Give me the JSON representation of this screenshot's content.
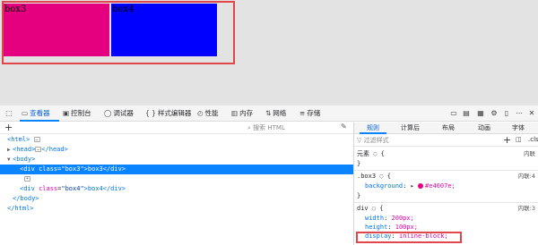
{
  "viewport": {
    "box3_label": "box3",
    "box4_label": "box4",
    "box3_color": "#e4007e",
    "box4_color": "#0000ff"
  },
  "toolbar": {
    "tabs": [
      {
        "icon": "inspector-icon",
        "label": "查看器"
      },
      {
        "icon": "console-icon",
        "label": "控制台"
      },
      {
        "icon": "debugger-icon",
        "label": "调试器"
      },
      {
        "icon": "style-editor-icon",
        "label": "样式编辑器",
        "prefix": "{ }"
      },
      {
        "icon": "performance-icon",
        "label": "性能"
      },
      {
        "icon": "memory-icon",
        "label": "内存"
      },
      {
        "icon": "network-icon",
        "label": "网络"
      },
      {
        "icon": "storage-icon",
        "label": "存储"
      }
    ]
  },
  "inspector": {
    "search_placeholder": "搜索 HTML",
    "tree": [
      {
        "indent": 0,
        "text_parts": [
          "<html>"
        ]
      },
      {
        "indent": 1,
        "text_parts": [
          "<head>",
          "</head>"
        ]
      },
      {
        "indent": 1,
        "text_parts": [
          "<body>"
        ]
      },
      {
        "indent": 2,
        "tag_open": "<div ",
        "attr": "class",
        "val": "\"box3\"",
        "content": ">box3</div>",
        "selected": true
      },
      {
        "indent": 2,
        "text_parts": [
          "<div ",
          "class",
          "\"box4\"",
          ">box4</div>"
        ]
      },
      {
        "indent": 1,
        "text_parts": [
          "</body>"
        ]
      },
      {
        "indent": 0,
        "text_parts": [
          "</html>"
        ]
      }
    ],
    "line_html": "<html>",
    "line_head_open": "<head>",
    "line_head_close": "</head>",
    "line_body": "<body>",
    "line_div3_open": "<div ",
    "line_div3_attr": "class",
    "line_div3_val": "\"box3\"",
    "line_div3_rest": ">box3</div>",
    "line_div4_open": "<div ",
    "line_div4_attr": "class",
    "line_div4_val": "\"box4\"",
    "line_div4_rest": ">box4</div>",
    "line_body_close": "</body>",
    "line_html_close": "</html>",
    "ellipsis": "…"
  },
  "rules_panel": {
    "tabs": [
      "规则",
      "计算后",
      "布局",
      "动画",
      "字体"
    ],
    "filter_placeholder": "过滤样式",
    "cls_label": ".cls",
    "element_selector": "元素",
    "element_brace": "{",
    "element_source": "内联",
    "close_brace": "}",
    "box3_selector": ".box3",
    "box3_source": "内联:4",
    "box3_prop": "background",
    "box3_value": "#e4007e;",
    "div_selector": "div",
    "div_source": "内联:3",
    "div_props": [
      {
        "name": "width",
        "value": "200px;"
      },
      {
        "name": "height",
        "value": "100px;"
      },
      {
        "name": "display",
        "value": "inline-block;"
      }
    ]
  }
}
